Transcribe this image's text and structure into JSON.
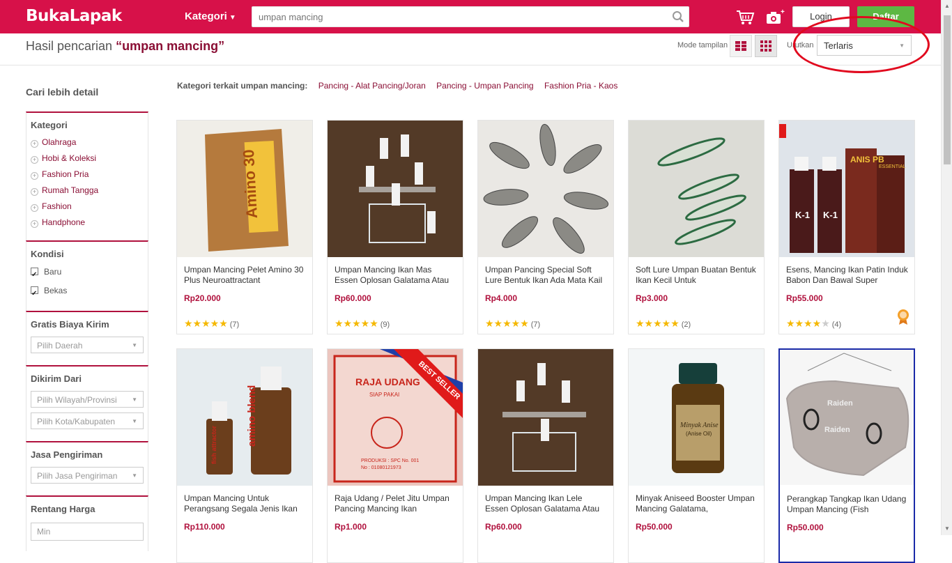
{
  "header": {
    "logo": "BukaLapak",
    "kategori_label": "Kategori",
    "search_placeholder": "umpan mancing",
    "login_label": "Login",
    "daftar_label": "Daftar"
  },
  "results": {
    "prefix": "Hasil pencarian ",
    "query": "“umpan mancing”",
    "mode_label": "Mode tampilan",
    "sort_label": "Urutkan",
    "sort_value": "Terlaris"
  },
  "sidebar": {
    "title": "Cari lebih detail",
    "kategori_head": "Kategori",
    "categories": [
      "Olahraga",
      "Hobi & Koleksi",
      "Fashion Pria",
      "Rumah Tangga",
      "Fashion",
      "Handphone"
    ],
    "kondisi_head": "Kondisi",
    "kondisi": [
      "Baru",
      "Bekas"
    ],
    "gratis_head": "Gratis Biaya Kirim",
    "gratis_select": "Pilih Daerah",
    "dikirim_head": "Dikirim Dari",
    "wilayah_select": "Pilih Wilayah/Provinsi",
    "kota_select": "Pilih Kota/Kabupaten",
    "jasa_head": "Jasa Pengiriman",
    "jasa_select": "Pilih Jasa Pengiriman",
    "harga_head": "Rentang Harga",
    "min_placeholder": "Min"
  },
  "related": {
    "label": "Kategori terkait umpan mancing:",
    "links": [
      "Pancing - Alat Pancing/Joran",
      "Pancing - Umpan Pancing",
      "Fashion Pria - Kaos"
    ]
  },
  "products": [
    {
      "name": "Umpan Mancing Pelet Amino 30 Plus Neuroattractant",
      "price": "Rp20.000",
      "rating": 5,
      "reviews": "(7)"
    },
    {
      "name": "Umpan Mancing Ikan Mas Essen Oplosan Galatama Atau",
      "price": "Rp60.000",
      "rating": 5,
      "reviews": "(9)"
    },
    {
      "name": "Umpan Pancing Special Soft Lure Bentuk Ikan Ada Mata Kail",
      "price": "Rp4.000",
      "rating": 5,
      "reviews": "(7)"
    },
    {
      "name": "Soft Lure Umpan Buatan Bentuk Ikan Kecil Untuk",
      "price": "Rp3.000",
      "rating": 5,
      "reviews": "(2)"
    },
    {
      "name": "Esens, Mancing Ikan Patin Induk Babon Dan Bawal Super",
      "price": "Rp55.000",
      "rating": 4,
      "reviews": "(4)"
    },
    {
      "name": "Umpan Mancing Untuk Perangsang Segala Jenis Ikan",
      "price": "Rp110.000"
    },
    {
      "name": "Raja Udang / Pelet Jitu Umpan Pancing Mancing Ikan",
      "price": "Rp1.000"
    },
    {
      "name": "Umpan Mancing Ikan Lele Essen Oplosan Galatama Atau",
      "price": "Rp60.000"
    },
    {
      "name": "Minyak Aniseed Booster Umpan Mancing Galatama,",
      "price": "Rp50.000"
    },
    {
      "name": "Perangkap Tangkap Ikan Udang Umpan Mancing (Fish",
      "price": "Rp50.000"
    }
  ],
  "image_text": {
    "amino": "Amino 30",
    "best_seller": "BEST SELLER",
    "raja_udang": "RAJA UDANG",
    "siap_pakai": "SIAP PAKAI",
    "produksi": "PRODUKSI : SPC  No. 001",
    "produksi_no": "No : 01080121973",
    "amino_blend": "amino blend",
    "fish_attractor": "fish attractor",
    "minyak_anise": "Minyak Anise",
    "anise_oil": "(Anise Oil)",
    "raiden": "Raiden",
    "k1": "K-1",
    "anis_pb": "ANIS PB",
    "essential": "ESSENTIAL"
  }
}
